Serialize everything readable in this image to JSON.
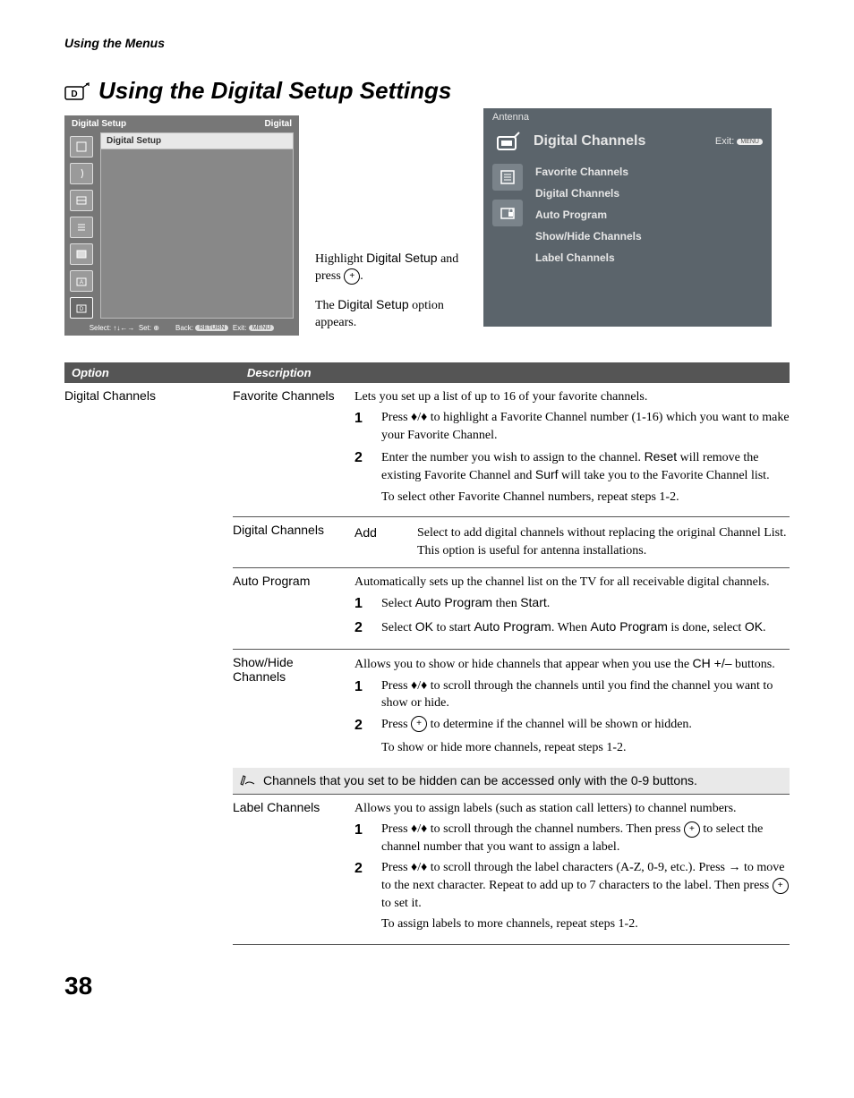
{
  "header": "Using the Menus",
  "title": "Using the Digital Setup Settings",
  "left_panel": {
    "title_left": "Digital Setup",
    "title_right": "Digital",
    "row": "Digital Setup",
    "footer_select": "Select:",
    "footer_select_glyph": "↑↓←→",
    "footer_set": "Set:",
    "footer_back": "Back:",
    "footer_back_pill": "RETURN",
    "footer_exit": "Exit:",
    "footer_exit_pill": "MENU"
  },
  "mid": {
    "p1a": "Highlight ",
    "p1b": "Digital Setup",
    "p1c": " and press ",
    "p1d": ".",
    "p2a": "The ",
    "p2b": "Digital Setup",
    "p2c": " option appears."
  },
  "right_panel": {
    "top": "Antenna",
    "title": "Digital Channels",
    "exit": "Exit:",
    "exit_pill": "MENU",
    "items": [
      "Favorite Channels",
      "Digital Channels",
      "Auto Program",
      "Show/Hide Channels",
      "Label Channels"
    ]
  },
  "table": {
    "head_option": "Option",
    "head_desc": "Description",
    "option": "Digital Channels",
    "fav": {
      "label": "Favorite Channels",
      "intro": "Lets you set up a list of up to 16 of your favorite channels.",
      "s1": "Press ♦/♦ to highlight a Favorite Channel number (1-16) which you want to make your Favorite Channel.",
      "s2a": "Enter the number you wish to assign to the channel. ",
      "s2b": "Reset",
      "s2c": " will remove the existing Favorite Channel and ",
      "s2d": "Surf",
      "s2e": " will take you to the Favorite Channel list.",
      "s_foot": "To select other Favorite Channel numbers, repeat steps 1-2."
    },
    "dig": {
      "label": "Digital Channels",
      "add_label": "Add",
      "add_text": "Select to add digital channels without replacing the original Channel List. This option is useful for antenna installations."
    },
    "auto": {
      "label": "Auto Program",
      "intro": "Automatically sets up the channel list on the TV for all receivable digital channels.",
      "s1a": "Select ",
      "s1b": "Auto Program",
      "s1c": " then ",
      "s1d": "Start",
      "s1e": ".",
      "s2a": "Select ",
      "s2b": "OK",
      "s2c": " to start ",
      "s2d": "Auto Program",
      "s2e": ". When ",
      "s2f": "Auto Program",
      "s2g": " is done, select ",
      "s2h": "OK",
      "s2i": "."
    },
    "show": {
      "label": "Show/Hide Channels",
      "intro_a": "Allows you to show or hide channels that appear when you use the ",
      "intro_b": "CH +/–",
      "intro_c": " buttons.",
      "s1": "Press ♦/♦ to scroll through the channels until you find the channel you want to show or hide.",
      "s2a": "Press ",
      "s2b": " to determine if the channel will be shown or hidden.",
      "s_foot": "To show or hide more channels, repeat steps 1-2."
    },
    "note": "Channels that you set to be hidden can be accessed only with the 0-9 buttons.",
    "label": {
      "label": "Label Channels",
      "intro": "Allows you to assign labels (such as station call letters) to channel numbers.",
      "s1a": "Press ♦/♦ to scroll through the channel numbers. Then press ",
      "s1b": " to select the channel number that you want to assign a label.",
      "s2a": "Press ♦/♦ to scroll through the label characters (A-Z, 0-9, etc.). Press → to move to the next character. Repeat to add up to 7 characters to the label. Then press ",
      "s2b": " to set it.",
      "s_foot": "To assign labels to more channels, repeat steps 1-2."
    }
  },
  "page": "38"
}
